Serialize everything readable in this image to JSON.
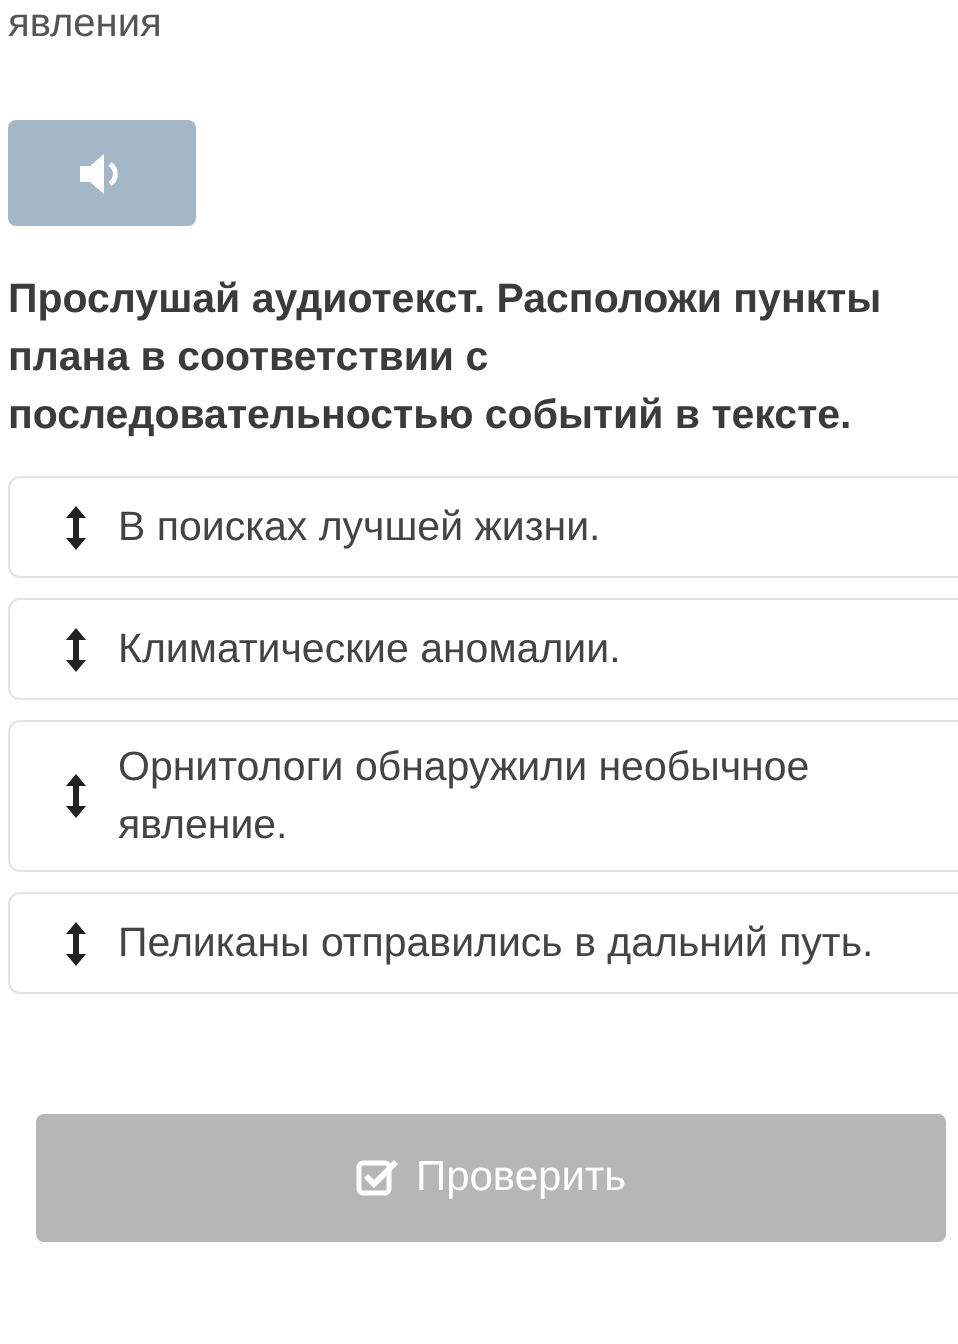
{
  "heading": "явления",
  "audio_button": {
    "kind": "sound"
  },
  "question": "Прослушай аудиотекст. Расположи пункты плана в соответствии с последовательностью событий в тексте.",
  "items": [
    {
      "text": "В поисках лучшей жизни."
    },
    {
      "text": "Климатические аномалии."
    },
    {
      "text": "Орнитологи обнаружили необычное явление."
    },
    {
      "text": "Пеликаны отправились в дальний путь."
    }
  ],
  "check_button": {
    "label": "Проверить",
    "disabled": true
  }
}
